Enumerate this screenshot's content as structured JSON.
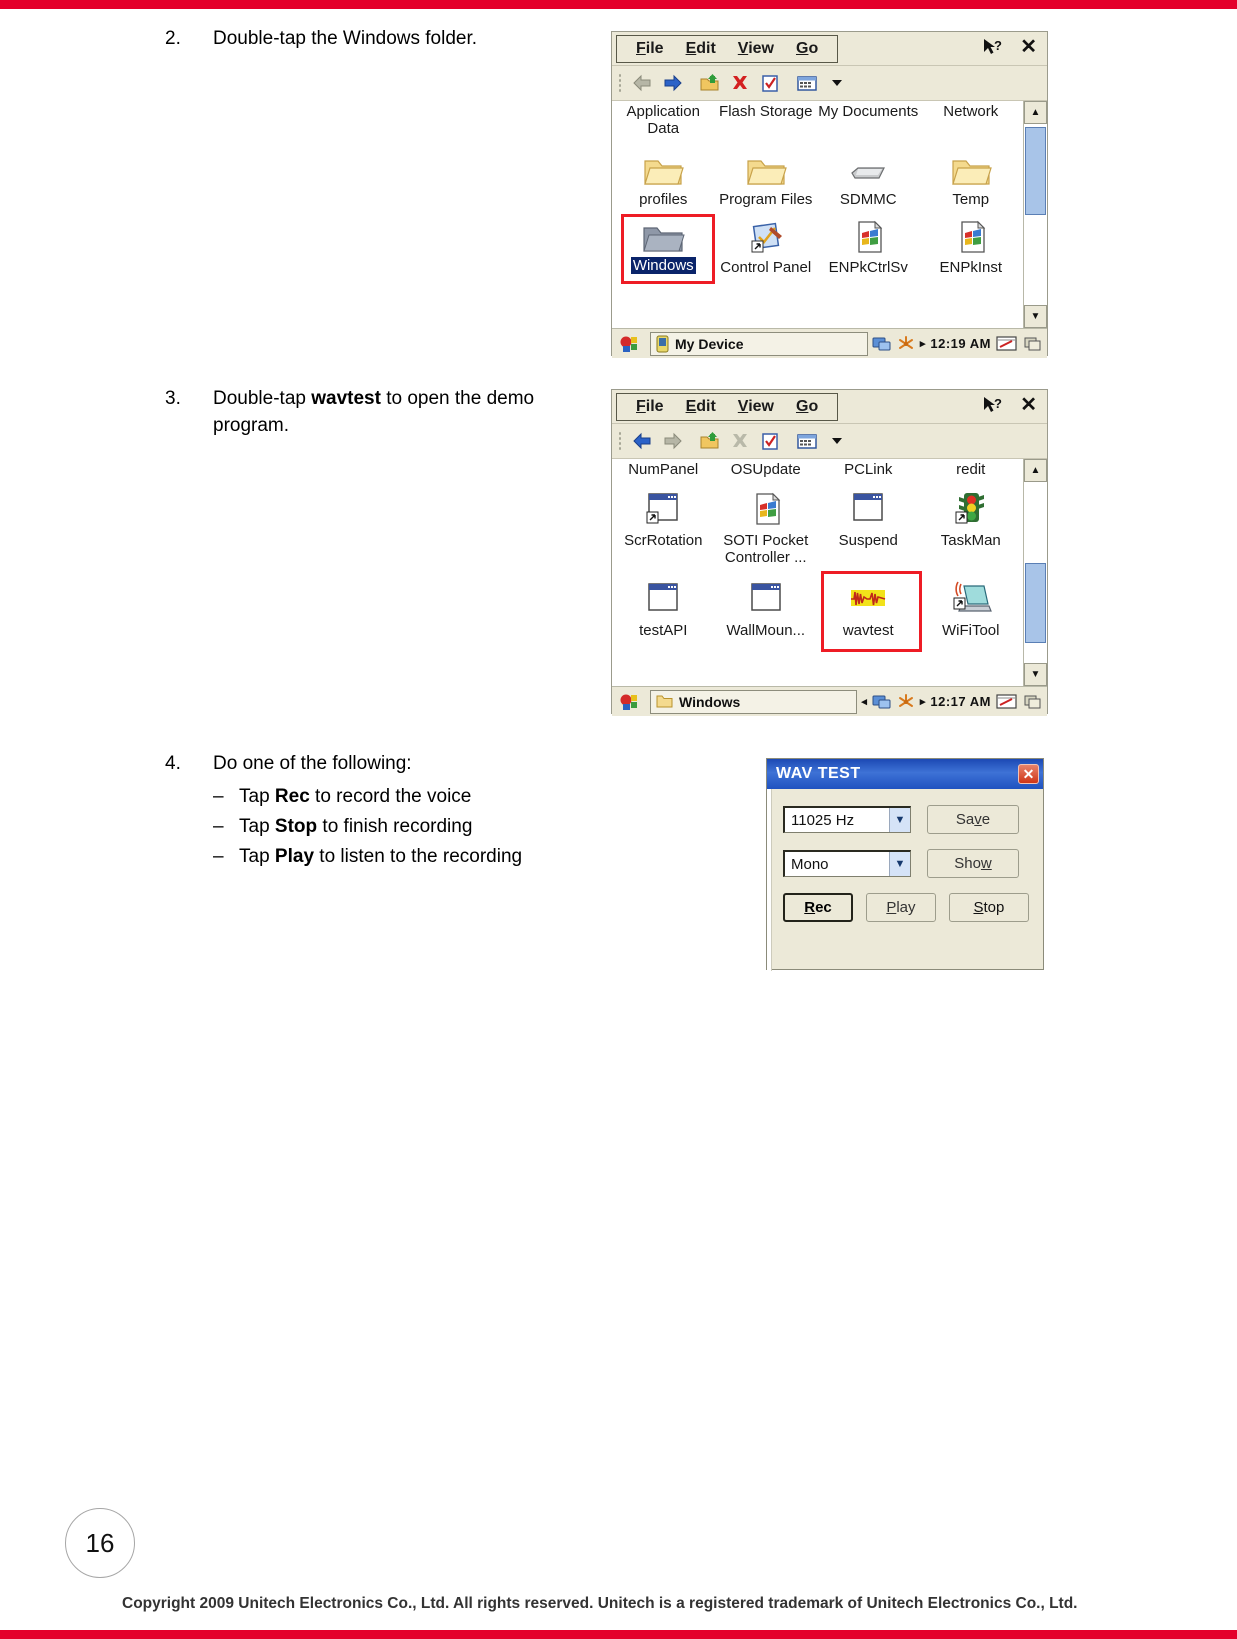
{
  "page": {
    "number": "16",
    "footer": "Copyright 2009 Unitech Electronics Co., Ltd. All rights reserved. Unitech is a registered trademark of Unitech Electronics Co., Ltd.",
    "accent_color": "#e4002b"
  },
  "steps": [
    {
      "number": "2.",
      "text_before": "Double-tap the Windows folder.",
      "bold": "",
      "text_after": ""
    },
    {
      "number": "3.",
      "text_before": "Double-tap ",
      "bold": "wavtest",
      "text_after": " to open the demo program."
    },
    {
      "number": "4.",
      "text_before": "Do one of the following:",
      "bold": "",
      "text_after": "",
      "sub_items": [
        {
          "dash": "–",
          "before": "Tap ",
          "bold": "Rec",
          "after": " to record the voice"
        },
        {
          "dash": "–",
          "before": "Tap ",
          "bold": "Stop",
          "after": " to finish recording"
        },
        {
          "dash": "–",
          "before": "Tap ",
          "bold": "Play",
          "after": " to listen to the recording"
        }
      ]
    }
  ],
  "explorer_my_device": {
    "menu": [
      {
        "accel": "F",
        "rest": "ile"
      },
      {
        "accel": "E",
        "rest": "dit"
      },
      {
        "accel": "V",
        "rest": "iew"
      },
      {
        "accel": "G",
        "rest": "o"
      }
    ],
    "toolbar_buttons": [
      "back-arrow-icon",
      "forward-arrow-icon",
      "up-folder-icon",
      "delete-icon",
      "properties-icon",
      "view-mode-icon",
      "view-mode-dropdown-icon"
    ],
    "help_icon": "context-help-icon",
    "close_icon": "close-icon",
    "icons": [
      {
        "label": "Application Data",
        "glyph": "folder-icon",
        "selected": false,
        "highlighted": false
      },
      {
        "label": "Flash Storage",
        "glyph": "folder-icon",
        "selected": false,
        "highlighted": false
      },
      {
        "label": "My Documents",
        "glyph": "folder-icon",
        "selected": false,
        "highlighted": false
      },
      {
        "label": "Network",
        "glyph": "folder-icon",
        "selected": false,
        "highlighted": false
      },
      {
        "label": "profiles",
        "glyph": "folder-icon",
        "selected": false,
        "highlighted": false
      },
      {
        "label": "Program Files",
        "glyph": "folder-icon",
        "selected": false,
        "highlighted": false
      },
      {
        "label": "SDMMC",
        "glyph": "storage-card-icon",
        "selected": false,
        "highlighted": false
      },
      {
        "label": "Temp",
        "glyph": "folder-icon",
        "selected": false,
        "highlighted": false
      },
      {
        "label": "Windows",
        "glyph": "folder-gray-icon",
        "selected": true,
        "highlighted": true
      },
      {
        "label": "Control Panel",
        "glyph": "control-panel-shortcut-icon",
        "selected": false,
        "highlighted": false
      },
      {
        "label": "ENPkCtrlSv",
        "glyph": "windows-exe-icon",
        "selected": false,
        "highlighted": false
      },
      {
        "label": "ENPkInst",
        "glyph": "windows-exe-icon",
        "selected": false,
        "highlighted": false
      }
    ],
    "taskbar": {
      "start_icon": "start-menu-icon",
      "task_icon": "device-icon",
      "task_label": "My Device",
      "tray_icons": [
        "network-tray-icon",
        "connection-tray-icon"
      ],
      "clock": "12:19 AM",
      "tray_right_icons": [
        "sip-keyboard-icon",
        "desktop-icon"
      ]
    }
  },
  "explorer_windows": {
    "menu": [
      {
        "accel": "F",
        "rest": "ile"
      },
      {
        "accel": "E",
        "rest": "dit"
      },
      {
        "accel": "V",
        "rest": "iew"
      },
      {
        "accel": "G",
        "rest": "o"
      }
    ],
    "toolbar_buttons": [
      "back-arrow-icon",
      "forward-arrow-icon",
      "up-folder-icon",
      "delete-icon",
      "properties-icon",
      "view-mode-icon",
      "view-mode-dropdown-icon"
    ],
    "help_icon": "context-help-icon",
    "close_icon": "close-icon",
    "partial_top_row": [
      "NumPanel",
      "OSUpdate",
      "PCLink",
      "redit"
    ],
    "icons": [
      {
        "label": "ScrRotation",
        "glyph": "app-shortcut-icon",
        "selected": false,
        "highlighted": false
      },
      {
        "label": "SOTI Pocket Controller ...",
        "glyph": "windows-exe-icon",
        "selected": false,
        "highlighted": false
      },
      {
        "label": "Suspend",
        "glyph": "app-window-icon",
        "selected": false,
        "highlighted": false
      },
      {
        "label": "TaskMan",
        "glyph": "traffic-light-icon",
        "selected": false,
        "highlighted": false
      },
      {
        "label": "testAPI",
        "glyph": "app-window-icon",
        "selected": false,
        "highlighted": false
      },
      {
        "label": "WallMoun...",
        "glyph": "app-window-icon",
        "selected": false,
        "highlighted": false
      },
      {
        "label": "wavtest",
        "glyph": "waveform-icon",
        "selected": false,
        "highlighted": true
      },
      {
        "label": "WiFiTool",
        "glyph": "wifi-laptop-icon",
        "selected": false,
        "highlighted": false
      }
    ],
    "taskbar": {
      "start_icon": "start-menu-icon",
      "task_icon": "folder-icon",
      "task_label": "Windows",
      "tray_icons": [
        "network-tray-icon",
        "connection-tray-icon"
      ],
      "clock": "12:17 AM",
      "tray_right_icons": [
        "sip-keyboard-icon",
        "desktop-icon"
      ]
    }
  },
  "wav_test_dialog": {
    "title": "WAV TEST",
    "close_icon": "close-icon",
    "sample_rate": {
      "value": "11025 Hz",
      "dropdown_icon": "chevron-down-icon"
    },
    "channels": {
      "value": "Mono",
      "dropdown_icon": "chevron-down-icon"
    },
    "buttons": {
      "save": {
        "before": "Sa",
        "accel": "v",
        "after": "e"
      },
      "show": {
        "before": "Sho",
        "accel": "w",
        "after": ""
      },
      "rec": {
        "before": "",
        "accel": "R",
        "after": "ec"
      },
      "play": {
        "before": "",
        "accel": "P",
        "after": "lay"
      },
      "stop": {
        "before": "",
        "accel": "S",
        "after": "top"
      }
    }
  }
}
